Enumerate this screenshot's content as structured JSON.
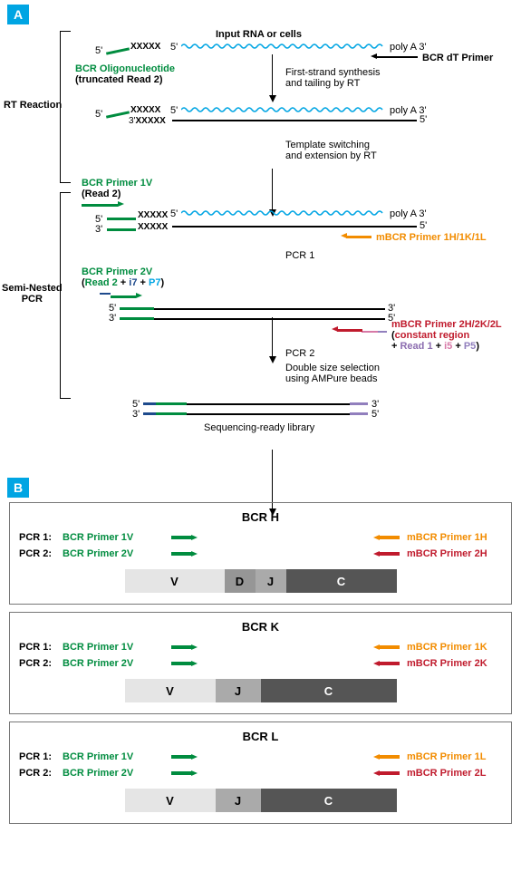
{
  "panelA_label": "A",
  "panelB_label": "B",
  "header": {
    "input_title": "Input RNA or cells",
    "polyA": "poly A 3'",
    "bcr_dt": "BCR dT Primer",
    "five": "5'",
    "three": "3'",
    "xxxxx": "XXXXX"
  },
  "labels": {
    "rt_reaction": "RT Reaction",
    "semi_nested": "Semi-Nested\nPCR",
    "bcr_oligo_t": "BCR Oligonucleotide",
    "bcr_oligo_b": "(truncated Read 2)",
    "step1a": "First-strand synthesis",
    "step1b": "and tailing by RT",
    "step2a": "Template switching",
    "step2b": "and extension by RT",
    "pcr1": "PCR 1",
    "pcr2": "PCR 2",
    "step3a": "Double size selection",
    "step3b": "using AMPure beads",
    "seq_ready": "Sequencing-ready library",
    "bcr_primer_1v_t": "BCR Primer 1V",
    "bcr_primer_1v_b": "(Read 2)",
    "bcr_primer_2v_t": "BCR Primer 2V",
    "bcr_primer_2v_b_pre": "(",
    "bcr_primer_2v_read2": "Read 2",
    "bcr_primer_2v_plus1": " + ",
    "bcr_primer_2v_i7": "i7",
    "bcr_primer_2v_plus2": " + ",
    "bcr_primer_2v_p7": "P7",
    "bcr_primer_2v_b_post": ")",
    "mbcr_primer_1": "mBCR Primer 1H/1K/1L",
    "mbcr_primer_2t": "mBCR Primer 2H/2K/2L",
    "mbcr_primer_2b_pre": "(",
    "mbcr_primer_2b_cr": "constant region",
    "mbcr_primer_2b_plus1": "+ ",
    "mbcr_primer_2b_r1": "Read 1",
    "mbcr_primer_2b_plus2": " + ",
    "mbcr_primer_2b_i5": "i5",
    "mbcr_primer_2b_plus3": " + ",
    "mbcr_primer_2b_p5": "P5",
    "mbcr_primer_2b_post": ")"
  },
  "panelB": {
    "pcr1_lab": "PCR 1:",
    "pcr2_lab": "PCR 2:",
    "primer1v": "BCR Primer 1V",
    "primer2v": "BCR Primer 2V",
    "V": "V",
    "D": "D",
    "J": "J",
    "C": "C",
    "groups": [
      {
        "title": "BCR H",
        "p1": "mBCR Primer 1H",
        "p2": "mBCR Primer 2H",
        "hasD": true
      },
      {
        "title": "BCR K",
        "p1": "mBCR Primer 1K",
        "p2": "mBCR Primer 2K",
        "hasD": false
      },
      {
        "title": "BCR L",
        "p1": "mBCR Primer 1L",
        "p2": "mBCR Primer 2L",
        "hasD": false
      }
    ]
  }
}
